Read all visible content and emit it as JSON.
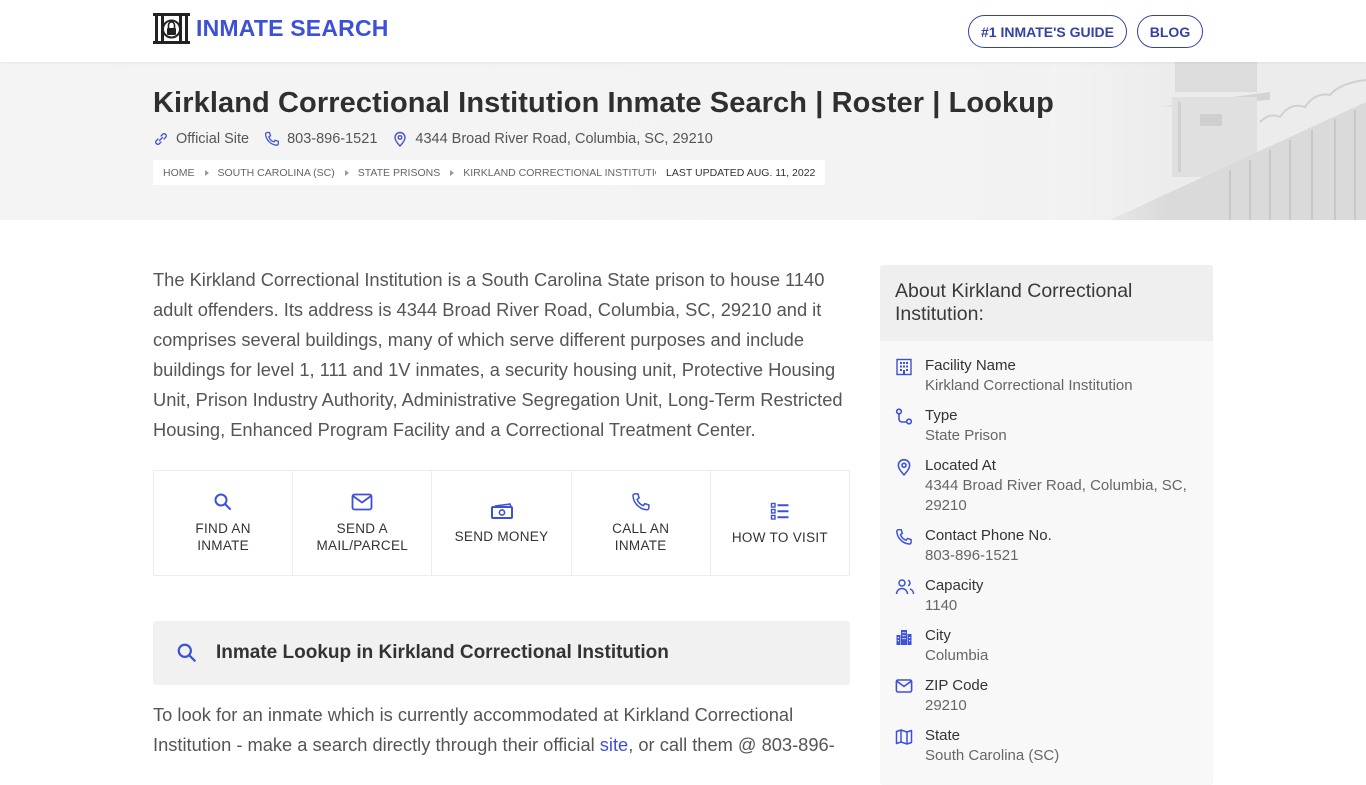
{
  "header": {
    "logo_text": "INMATE SEARCH",
    "nav": [
      {
        "label": "#1 INMATE'S GUIDE"
      },
      {
        "label": "BLOG"
      }
    ]
  },
  "hero": {
    "title": "Kirkland Correctional Institution Inmate Search | Roster | Lookup",
    "official_site": "Official Site",
    "phone": "803-896-1521",
    "address": "4344 Broad River Road, Columbia, SC, 29210",
    "breadcrumb": [
      "HOME",
      "SOUTH CAROLINA (SC)",
      "STATE PRISONS",
      "KIRKLAND CORRECTIONAL INSTITUTION"
    ],
    "last_updated": "LAST UPDATED AUG. 11, 2022"
  },
  "intro": "The Kirkland Correctional Institution is a South Carolina State prison to house 1140 adult offenders. Its address is 4344 Broad River Road, Columbia, SC, 29210 and it comprises several buildings, many of which serve different purposes and include buildings for level 1, 111 and 1V inmates, a security housing unit, Protective Housing Unit, Prison Industry Authority, Administrative Segregation Unit, Long-Term Restricted Housing, Enhanced Program Facility and a Correctional Treatment Center.",
  "actions": [
    {
      "label": "FIND AN\nINMATE",
      "icon": "search-icon"
    },
    {
      "label": "SEND A\nMAIL/PARCEL",
      "icon": "mail-icon"
    },
    {
      "label": "SEND MONEY",
      "icon": "money-icon"
    },
    {
      "label": "CALL AN\nINMATE",
      "icon": "phone-icon"
    },
    {
      "label": "HOW TO VISIT",
      "icon": "list-icon"
    }
  ],
  "lookup": {
    "title": "Inmate Lookup in Kirkland Correctional Institution",
    "text_before": "To look for an inmate which is currently accommodated at Kirkland Correctional Institution - make a search directly through their official ",
    "link": "site",
    "text_after": ", or call them @ 803-896-"
  },
  "about": {
    "title": "About Kirkland Correctional Institution:",
    "items": [
      {
        "key": "Facility Name",
        "value": "Kirkland Correctional Institution",
        "icon": "building-icon"
      },
      {
        "key": "Type",
        "value": "State Prison",
        "icon": "route-icon"
      },
      {
        "key": "Located At",
        "value": "4344 Broad River Road, Columbia, SC, 29210",
        "icon": "location-pin-icon"
      },
      {
        "key": "Contact Phone No.",
        "value": "803-896-1521",
        "icon": "phone-icon"
      },
      {
        "key": "Capacity",
        "value": "1140",
        "icon": "users-icon"
      },
      {
        "key": "City",
        "value": "Columbia",
        "icon": "city-icon"
      },
      {
        "key": "ZIP Code",
        "value": "29210",
        "icon": "mail-icon"
      },
      {
        "key": "State",
        "value": "South Carolina (SC)",
        "icon": "map-icon"
      }
    ]
  },
  "colors": {
    "accent": "#3d51d8",
    "nav_border": "#3442a8",
    "hero_bg": "#f4f4f4",
    "panel_bg": "#f1f1f1"
  }
}
